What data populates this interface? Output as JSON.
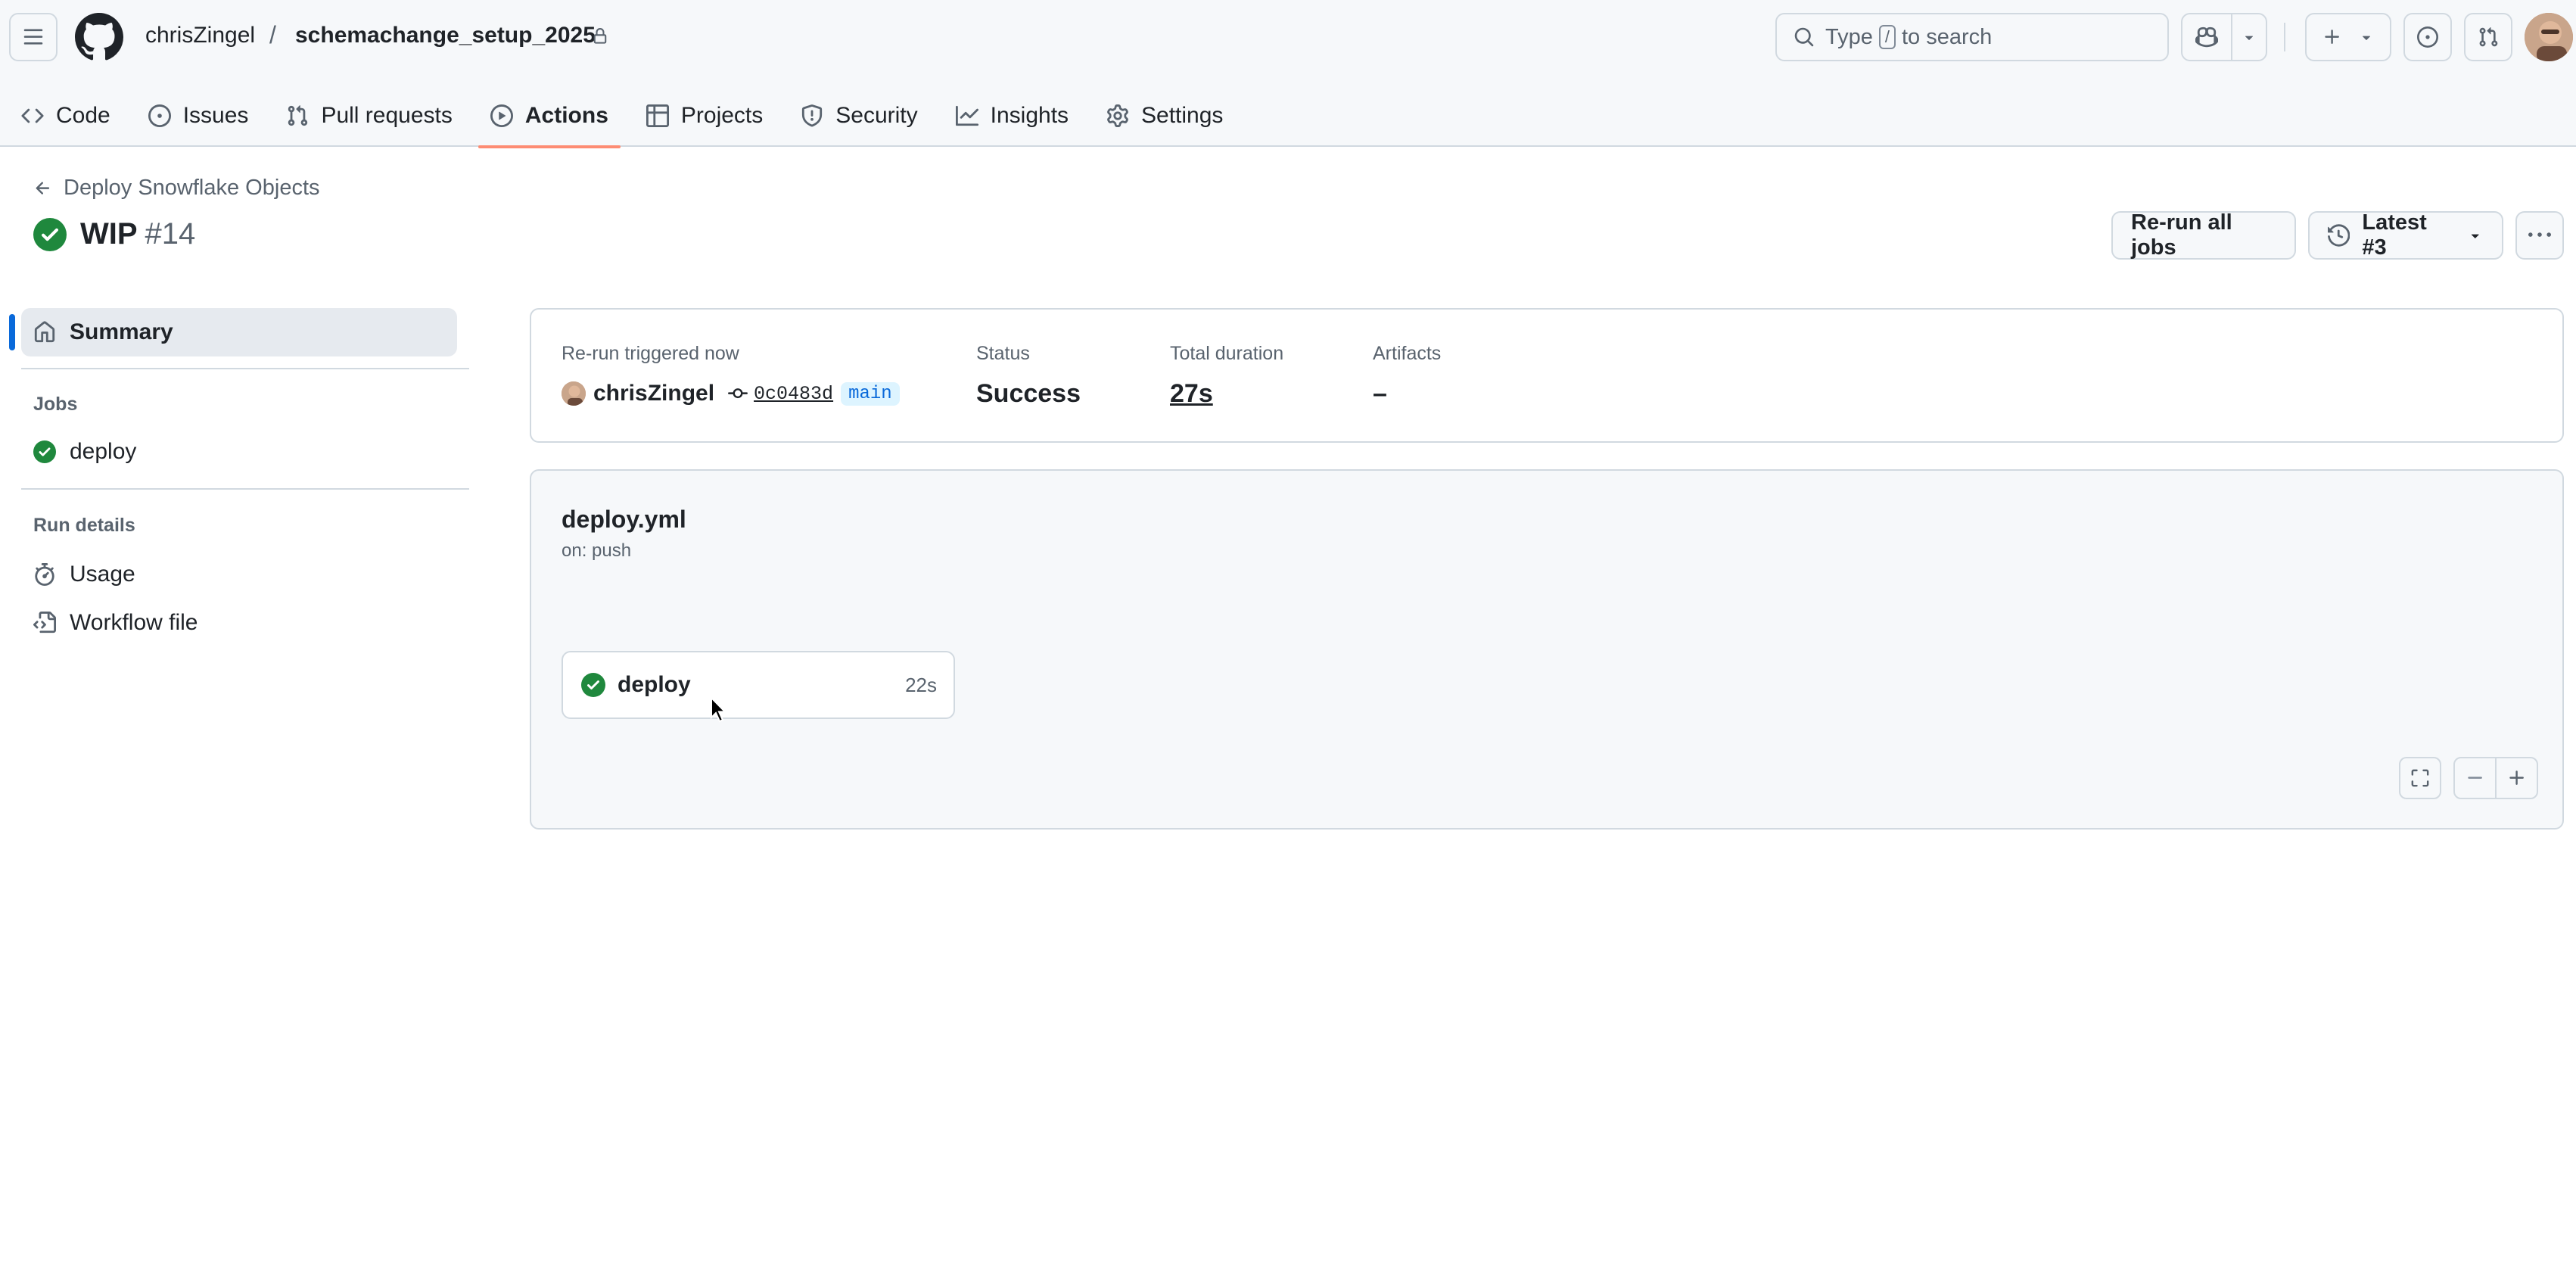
{
  "header": {
    "owner": "chrisZingel",
    "separator": "/",
    "repo": "schemachange_setup_2025",
    "search": {
      "prefix": "Type",
      "key": "/",
      "suffix": "to search"
    }
  },
  "repo_nav": {
    "tabs": [
      {
        "label": "Code",
        "icon": "code-icon",
        "active": false
      },
      {
        "label": "Issues",
        "icon": "issue-opened-icon",
        "active": false
      },
      {
        "label": "Pull requests",
        "icon": "git-pull-request-icon",
        "active": false
      },
      {
        "label": "Actions",
        "icon": "play-icon",
        "active": true
      },
      {
        "label": "Projects",
        "icon": "table-icon",
        "active": false
      },
      {
        "label": "Security",
        "icon": "shield-icon",
        "active": false
      },
      {
        "label": "Insights",
        "icon": "graph-icon",
        "active": false
      },
      {
        "label": "Settings",
        "icon": "gear-icon",
        "active": false
      }
    ]
  },
  "run": {
    "workflow_name": "Deploy Snowflake Objects",
    "title": "WIP",
    "number": "#14",
    "rerun_label": "Re-run all jobs",
    "attempt_label": "Latest #3"
  },
  "sidebar": {
    "summary_label": "Summary",
    "jobs_heading": "Jobs",
    "jobs": [
      {
        "label": "deploy",
        "status": "success"
      }
    ],
    "run_details_heading": "Run details",
    "details": [
      {
        "label": "Usage",
        "icon": "stopwatch-icon"
      },
      {
        "label": "Workflow file",
        "icon": "file-code-icon"
      }
    ]
  },
  "summary": {
    "trigger_label": "Re-run triggered now",
    "actor": "chrisZingel",
    "commit_sha": "0c0483d",
    "branch": "main",
    "status_label": "Status",
    "status_value": "Success",
    "duration_label": "Total duration",
    "duration_value": "27s",
    "artifacts_label": "Artifacts",
    "artifacts_value": "–"
  },
  "workflow": {
    "file": "deploy.yml",
    "trigger": "on: push",
    "jobs": [
      {
        "name": "deploy",
        "duration": "22s",
        "status": "success"
      }
    ]
  },
  "colors": {
    "success": "#1f883d",
    "accent": "#0969da",
    "active_tab_underline": "#fd8c73",
    "border": "#d1d9e0",
    "muted_text": "#59636e"
  }
}
